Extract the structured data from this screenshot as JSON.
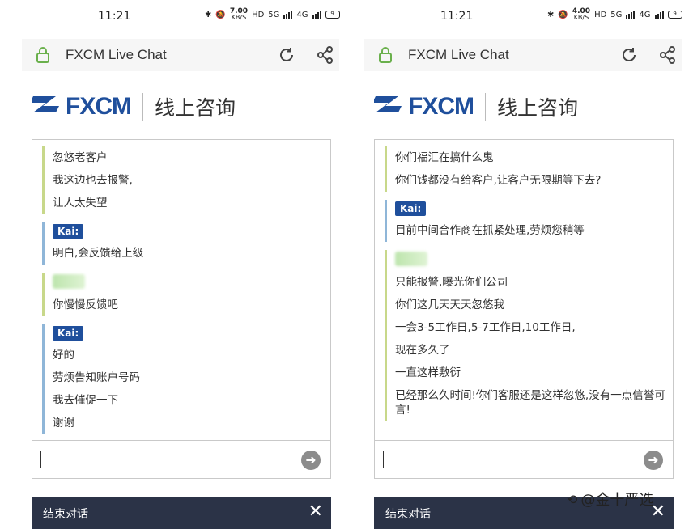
{
  "left": {
    "status": {
      "time": "11:21",
      "speed": "7.00",
      "speed_unit": "KB/S",
      "hd": "HD",
      "net1": "5G",
      "net2": "4G",
      "battery": "9"
    },
    "topbar": {
      "title": "FXCM Live Chat"
    },
    "brand": {
      "logo": "FXCM",
      "subtitle": "线上咨询"
    },
    "messages": [
      {
        "role": "customer",
        "lines": [
          "忽悠老客户",
          "我这边也去报警,",
          "让人太失望"
        ]
      },
      {
        "role": "agent",
        "name": "Kai:",
        "lines": [
          "明白,会反馈给上级"
        ]
      },
      {
        "role": "customer",
        "lines": [
          "你慢慢反馈吧"
        ]
      },
      {
        "role": "agent",
        "name": "Kai:",
        "lines": [
          "好的",
          "劳烦告知账户号码",
          "我去催促一下",
          "谢谢"
        ]
      }
    ],
    "end_label": "结束对话",
    "send_icon": "send-arrow-icon"
  },
  "right": {
    "status": {
      "time": "11:21",
      "speed": "4.00",
      "speed_unit": "KB/S",
      "hd": "HD",
      "net1": "5G",
      "net2": "4G",
      "battery": "9"
    },
    "topbar": {
      "title": "FXCM Live Chat"
    },
    "brand": {
      "logo": "FXCM",
      "subtitle": "线上咨询"
    },
    "messages": [
      {
        "role": "customer",
        "lines": [
          "你们福汇在搞什么鬼",
          "你们钱都没有给客户,让客户无限期等下去?"
        ]
      },
      {
        "role": "agent",
        "name": "Kai:",
        "lines": [
          "目前中间合作商在抓紧处理,劳烦您稍等"
        ]
      },
      {
        "role": "customer",
        "lines": [
          "只能报警,曝光你们公司",
          "你们这几天天天忽悠我",
          "一会3-5工作日,5-7工作日,10工作日,",
          "现在多久了",
          "一直这样敷衍",
          "已经那么久时间!你们客服还是这样忽悠,没有一点信誉可言!"
        ]
      }
    ],
    "end_label": "结束对话",
    "send_icon": "send-arrow-icon"
  },
  "watermark": {
    "text": "@金十严选"
  },
  "colors": {
    "brand_blue": "#1f4f9c",
    "end_bar": "#2b3347",
    "customer_border": "#c8d88a",
    "agent_border": "#8fb6d8"
  }
}
